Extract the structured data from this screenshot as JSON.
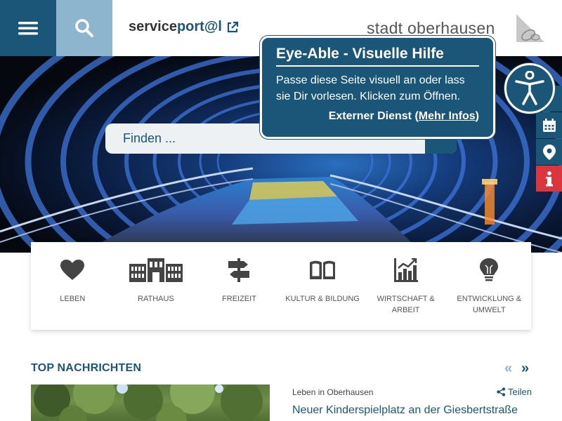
{
  "header": {
    "serviceportal": {
      "part1": "service",
      "part2": "port@l"
    },
    "logo_text": "stadt oberhausen"
  },
  "search": {
    "placeholder": "Finden ..."
  },
  "eye_able": {
    "title": "Eye-Able - Visuelle Hilfe",
    "description": "Passe diese Seite visuell an oder lass sie Dir vorlesen. Klicken zum Öffnen.",
    "footer_prefix": "Externer Dienst (",
    "footer_link": "Mehr Infos",
    "footer_suffix": ")"
  },
  "side_tabs": [
    {
      "icon": "calendar-icon",
      "color": "#1b5577"
    },
    {
      "icon": "location-pin-icon",
      "color": "#1b5577"
    },
    {
      "icon": "info-icon",
      "color": "#d9363e"
    }
  ],
  "categories": [
    {
      "label": "LEBEN",
      "icon": "heart-icon"
    },
    {
      "label": "RATHAUS",
      "icon": "building-icon"
    },
    {
      "label": "FREIZEIT",
      "icon": "signpost-icon"
    },
    {
      "label": "KULTUR & BILDUNG",
      "icon": "book-icon"
    },
    {
      "label": "WIRTSCHAFT & ARBEIT",
      "icon": "chart-icon"
    },
    {
      "label": "ENTWICKLUNG & UMWELT",
      "icon": "lightbulb-icon"
    }
  ],
  "news": {
    "heading": "TOP NACHRICHTEN",
    "prev": "«",
    "next": "»",
    "category": "Leben in Oberhausen",
    "share_label": "Teilen",
    "title": "Neuer Kinderspielplatz an der Giesbertstraße"
  },
  "colors": {
    "primary": "#1b5577",
    "light": "#8db5cd",
    "info": "#d9363e"
  }
}
